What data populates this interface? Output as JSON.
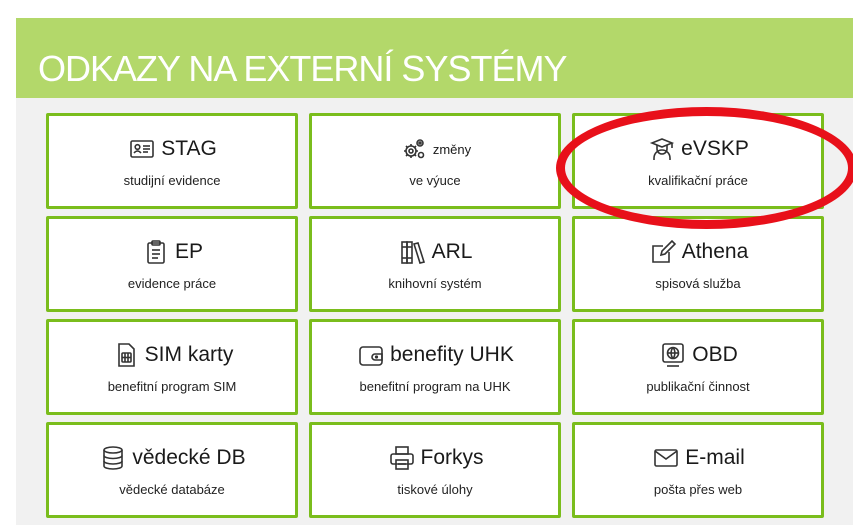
{
  "panel": {
    "title": "ODKAZY NA EXTERNÍ SYSTÉMY"
  },
  "tiles": [
    {
      "icon": "id-card-icon",
      "label": "STAG",
      "sub": "studijní evidence"
    },
    {
      "icon": "gears-icon",
      "label": "změny",
      "sub": "ve výuce"
    },
    {
      "icon": "graduate-icon",
      "label": "eVSKP",
      "sub": "kvalifikační práce"
    },
    {
      "icon": "clipboard-icon",
      "label": "EP",
      "sub": "evidence práce"
    },
    {
      "icon": "books-icon",
      "label": "ARL",
      "sub": "knihovní systém"
    },
    {
      "icon": "edit-icon",
      "label": "Athena",
      "sub": "spisová služba"
    },
    {
      "icon": "sim-card-icon",
      "label": "SIM karty",
      "sub": "benefitní program SIM"
    },
    {
      "icon": "wallet-icon",
      "label": "benefity UHK",
      "sub": "benefitní program na UHK"
    },
    {
      "icon": "globe-screen-icon",
      "label": "OBD",
      "sub": "publikační činnost"
    },
    {
      "icon": "database-icon",
      "label": "vědecké DB",
      "sub": "vědecké databáze"
    },
    {
      "icon": "printer-icon",
      "label": "Forkys",
      "sub": "tiskové úlohy"
    },
    {
      "icon": "envelope-icon",
      "label": "E-mail",
      "sub": "pošta přes web"
    }
  ],
  "colors": {
    "header": "#b3d86a",
    "tile_border": "#7abd1c",
    "highlight": "#e8101a"
  }
}
